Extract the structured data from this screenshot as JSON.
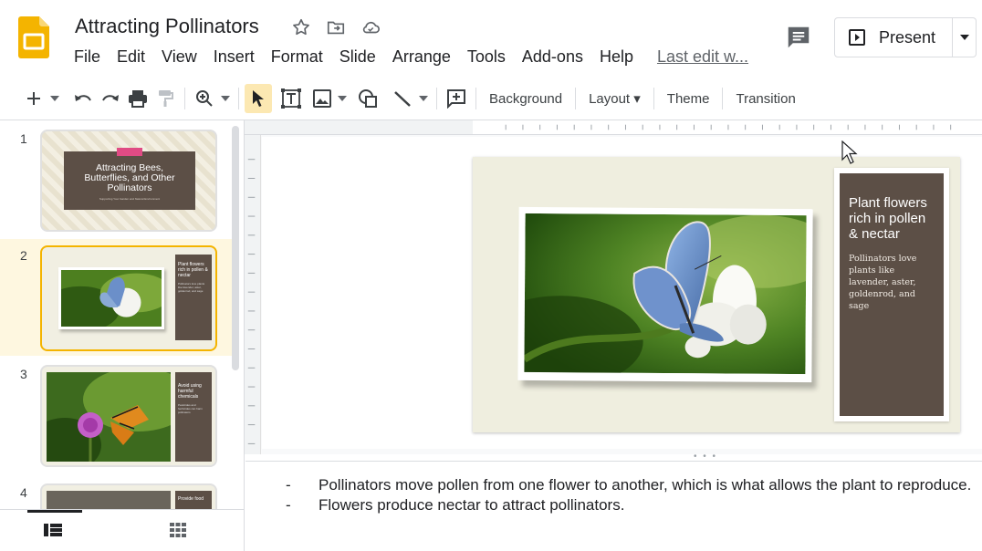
{
  "doc": {
    "title": "Attracting Pollinators"
  },
  "menu": {
    "items": [
      "File",
      "Edit",
      "View",
      "Insert",
      "Format",
      "Slide",
      "Arrange",
      "Tools",
      "Add-ons",
      "Help"
    ],
    "last_edit": "Last edit w..."
  },
  "present": {
    "label": "Present"
  },
  "toolbar": {
    "background_label": "Background",
    "layout_label": "Layout ▾",
    "theme_label": "Theme",
    "transition_label": "Transition"
  },
  "filmstrip": {
    "slides": [
      {
        "number": "1",
        "title": "Attracting Bees, Butterflies, and Other Pollinators",
        "subtitle": "Supporting Your Garden and Natural Environment"
      },
      {
        "number": "2",
        "title": "Plant flowers rich in pollen & nectar",
        "body": "Pollinators love plants like lavender, aster, goldenrod, and sage"
      },
      {
        "number": "3",
        "title": "Avoid using harmful chemicals",
        "body": "Pesticides and herbicides can harm pollinators"
      },
      {
        "number": "4",
        "title": "Provide food"
      }
    ]
  },
  "slide": {
    "heading": "Plant flowers rich in pollen & nectar",
    "body": "Pollinators love plants like lavender, aster, goldenrod, and sage"
  },
  "notes": {
    "lines": [
      "Pollinators move pollen from one flower to another, which is what allows the plant to reproduce.",
      "Flowers produce nectar to attract pollinators."
    ]
  },
  "colors": {
    "accent": "#f4b400",
    "card": "#5c4f46",
    "slide_bg": "#efeedf",
    "selected_row": "#fef7e0"
  }
}
